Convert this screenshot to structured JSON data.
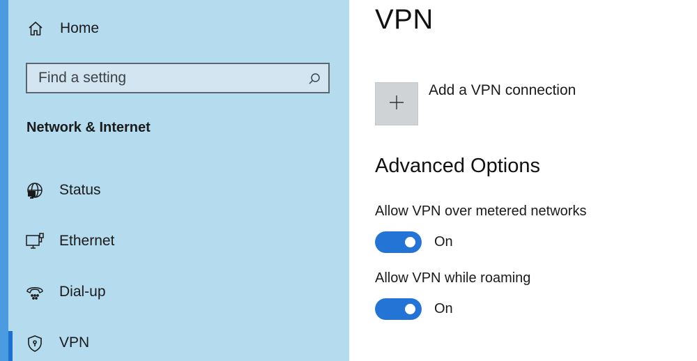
{
  "sidebar": {
    "home_label": "Home",
    "search": {
      "placeholder": "Find a setting",
      "value": ""
    },
    "section_title": "Network & Internet",
    "items": [
      {
        "label": "Status",
        "icon": "globe-monitor-icon"
      },
      {
        "label": "Ethernet",
        "icon": "ethernet-icon"
      },
      {
        "label": "Dial-up",
        "icon": "dial-up-icon"
      },
      {
        "label": "VPN",
        "icon": "shield-icon",
        "selected": true
      }
    ]
  },
  "main": {
    "title": "VPN",
    "add_vpn_label": "Add a VPN connection",
    "advanced_title": "Advanced Options",
    "options": [
      {
        "label": "Allow VPN over metered networks",
        "state": "On",
        "on": true
      },
      {
        "label": "Allow VPN while roaming",
        "state": "On",
        "on": true
      }
    ]
  },
  "colors": {
    "sidebar_bg": "#b5dbef",
    "accent": "#2474d6",
    "selection_indicator": "#1f6fd1"
  }
}
